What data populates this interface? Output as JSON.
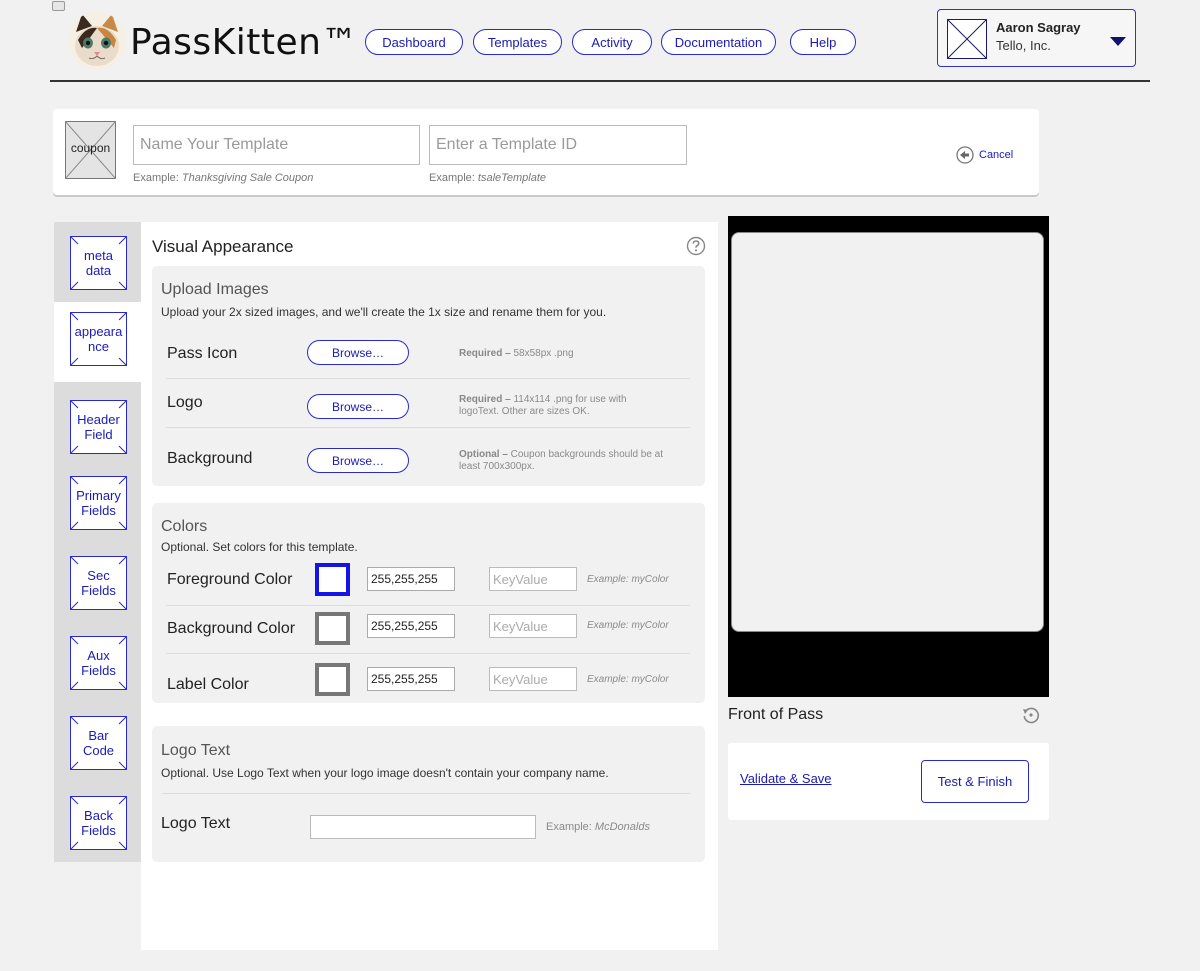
{
  "app": {
    "brand": "PassKitten™"
  },
  "nav": {
    "items": [
      {
        "label": "Dashboard"
      },
      {
        "label": "Templates"
      },
      {
        "label": "Activity"
      },
      {
        "label": "Documentation"
      },
      {
        "label": "Help"
      }
    ]
  },
  "user": {
    "name": "Aaron Sagray",
    "company": "Tello, Inc."
  },
  "template": {
    "thumb_label": "coupon",
    "name_placeholder": "Name Your Template",
    "id_placeholder": "Enter a Template ID",
    "name_example_prefix": "Example:",
    "name_example": "Thanksgiving Sale Coupon",
    "id_example_prefix": "Example:",
    "id_example": "tsaleTemplate",
    "cancel_label": "Cancel"
  },
  "sidebar": {
    "items": [
      {
        "line1": "meta",
        "line2": "data"
      },
      {
        "line1": "appeara",
        "line2": "nce"
      },
      {
        "line1": "Header",
        "line2": "Field"
      },
      {
        "line1": "Primary",
        "line2": "Fields"
      },
      {
        "line1": "Sec",
        "line2": "Fields"
      },
      {
        "line1": "Aux",
        "line2": "Fields"
      },
      {
        "line1": "Bar",
        "line2": "Code"
      },
      {
        "line1": "Back",
        "line2": "Fields"
      }
    ]
  },
  "main": {
    "title": "Visual Appearance",
    "upload": {
      "title": "Upload Images",
      "desc": "Upload your 2x sized images, and we'll create the 1x size and rename them for you.",
      "rows": [
        {
          "label": "Pass Icon",
          "button": "Browse…",
          "note_strong": "Required –",
          "note": " 58x58px .png"
        },
        {
          "label": "Logo",
          "button": "Browse…",
          "note_strong": "Required –",
          "note": " 114x114 .png for use with logoText. Other are sizes OK."
        },
        {
          "label": "Background",
          "button": "Browse…",
          "note_strong": "Optional –",
          "note": " Coupon backgrounds should be at least 700x300px."
        }
      ]
    },
    "colors": {
      "title": "Colors",
      "desc": "Optional. Set colors for this template.",
      "rows": [
        {
          "label": "Foreground Color",
          "value": "255,255,255",
          "key_placeholder": "KeyValue",
          "example": "Example: myColor",
          "border": "#1414e6"
        },
        {
          "label": "Background Color",
          "value": "255,255,255",
          "key_placeholder": "KeyValue",
          "example": "Example: myColor",
          "border": "#777777"
        },
        {
          "label": "Label Color",
          "value": "255,255,255",
          "key_placeholder": "KeyValue",
          "example": "Example: myColor",
          "border": "#777777"
        }
      ]
    },
    "logo_text": {
      "title": "Logo Text",
      "desc": "Optional. Use Logo Text when your logo image doesn't contain your company name.",
      "label": "Logo Text",
      "value": "",
      "example_prefix": "Example:",
      "example": "McDonalds"
    }
  },
  "preview": {
    "label": "Front of Pass",
    "validate_label": "Validate & Save",
    "finish_label": "Test & Finish"
  },
  "colors": {
    "accent": "#1a1ab8",
    "accent_border": "#2a2ac9"
  },
  "icons": {
    "help": "question-circle-icon",
    "cancel": "back-arrow-circle-icon",
    "flip": "rotate-icon",
    "caret": "caret-down-icon"
  }
}
